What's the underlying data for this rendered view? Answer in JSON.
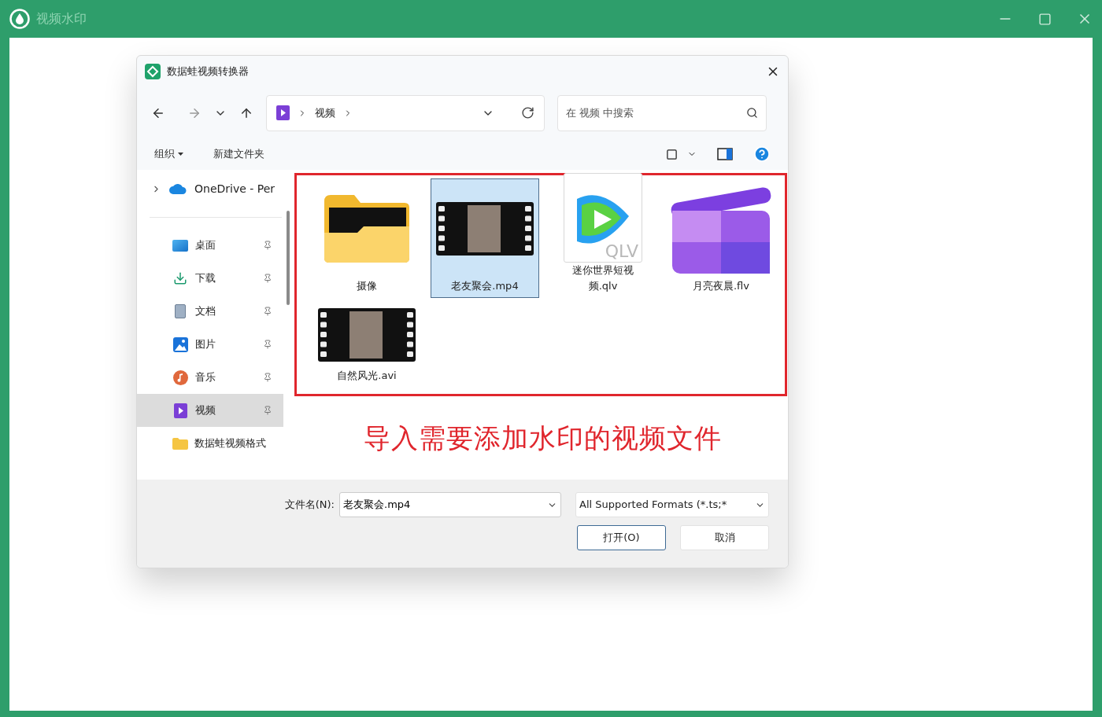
{
  "app": {
    "title": "视频水印"
  },
  "dialog": {
    "title": "数据蛙视频转换器",
    "breadcrumb": [
      "视频"
    ],
    "search": {
      "placeholder": "在 视频 中搜索"
    },
    "toolbar": {
      "organize": "组织",
      "new_folder": "新建文件夹"
    },
    "sidebar": {
      "onedrive": "OneDrive - Per",
      "items": [
        {
          "label": "桌面",
          "kind": "desktop",
          "pinned": true,
          "selected": false
        },
        {
          "label": "下载",
          "kind": "download",
          "pinned": true,
          "selected": false
        },
        {
          "label": "文档",
          "kind": "document",
          "pinned": true,
          "selected": false
        },
        {
          "label": "图片",
          "kind": "pictures",
          "pinned": true,
          "selected": false
        },
        {
          "label": "音乐",
          "kind": "music",
          "pinned": true,
          "selected": false
        },
        {
          "label": "视频",
          "kind": "videos",
          "pinned": true,
          "selected": true
        },
        {
          "label": "数据蛙视频格式",
          "kind": "folder",
          "pinned": false,
          "selected": false
        }
      ]
    },
    "files": [
      {
        "name": "摄像",
        "kind": "folder",
        "selected": false
      },
      {
        "name": "老友聚会.mp4",
        "kind": "video",
        "selected": true
      },
      {
        "name": "迷你世界短视频.qlv",
        "kind": "qlv",
        "badge": "QLV",
        "selected": false
      },
      {
        "name": "月亮夜晨.flv",
        "kind": "flv",
        "selected": false
      },
      {
        "name": "自然风光.avi",
        "kind": "video",
        "selected": false
      }
    ],
    "annotation": {
      "text": "导入需要添加水印的视频文件"
    },
    "footer": {
      "filename_label": "文件名(N):",
      "filename": "老友聚会.mp4",
      "filter": "All Supported Formats (*.ts;*",
      "buttons": [
        {
          "label": "打开(O)",
          "kind": "primary"
        },
        {
          "label": "取消",
          "kind": "secondary"
        }
      ]
    }
  }
}
